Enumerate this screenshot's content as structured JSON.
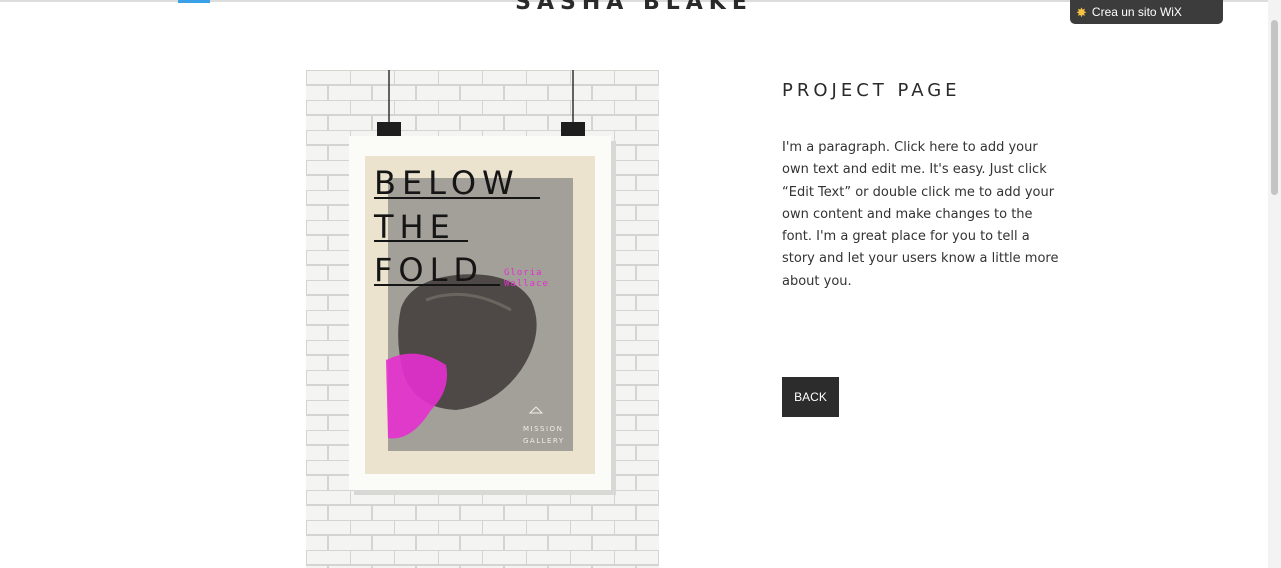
{
  "header": {
    "site_title": "SASHA BLAKE"
  },
  "wix_badge": {
    "label": "Crea un sito WiX",
    "icon": "wix-star-icon"
  },
  "project": {
    "title": "PROJECT PAGE",
    "paragraph": "I'm a paragraph. Click here to add your own text and edit me. It's easy. Just click “Edit Text” or double click me to add your own content and make changes to the font. I'm a great place for you to tell a story and let your users know a little more about you.",
    "back_label": "BACK"
  },
  "poster": {
    "title_line1": "BELOW",
    "title_line2": "THE",
    "title_line3": "FOLD",
    "author_line1": "Gloria",
    "author_line2": "Wallace",
    "gallery_line1": "MISSION",
    "gallery_line2": "GALLERY"
  },
  "colors": {
    "accent_blue": "#3aa0e8",
    "button_bg": "#2c2c2c",
    "poster_pink": "#e62fcf"
  }
}
